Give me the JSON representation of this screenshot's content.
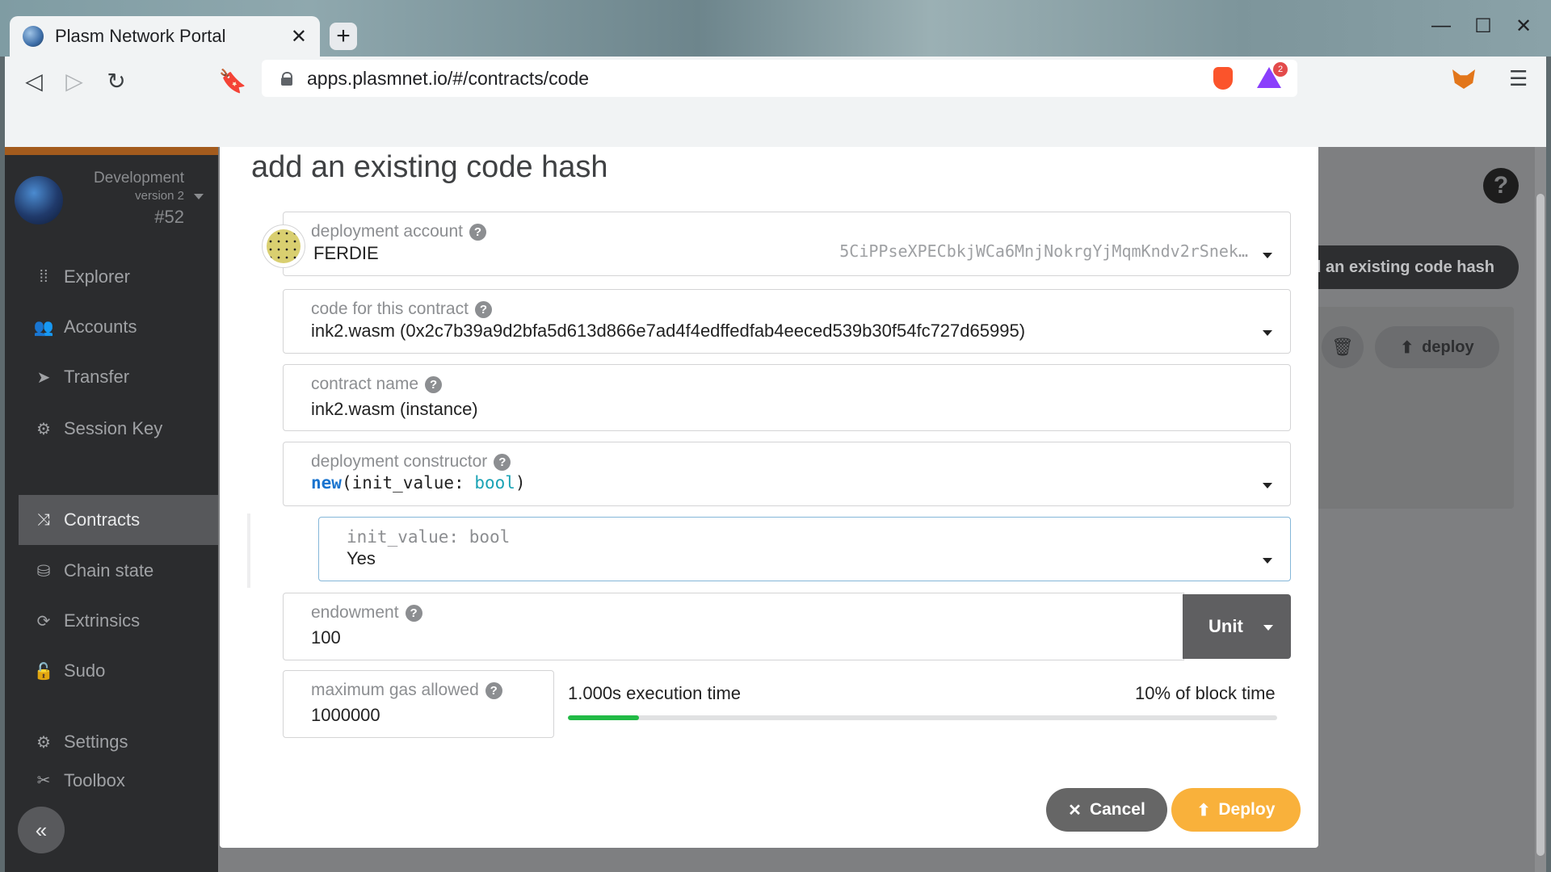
{
  "browser": {
    "tab_title": "Plasm Network Portal",
    "tab_close": "✕",
    "new_tab": "+",
    "url": "apps.plasmnet.io/#/contracts/code",
    "rewards_badge": "2",
    "window": {
      "minimize": "—",
      "maximize": "☐",
      "close": "✕"
    }
  },
  "sidebar": {
    "chain_name": "Development",
    "chain_version": "version 2",
    "block": "#52",
    "items": [
      {
        "label": "Explorer",
        "icon": "explorer-icon",
        "glyph": "⁞⁞"
      },
      {
        "label": "Accounts",
        "icon": "users-icon",
        "glyph": "👥"
      },
      {
        "label": "Transfer",
        "icon": "paper-plane-icon",
        "glyph": "➤"
      },
      {
        "label": "Session Key",
        "icon": "cog-icon",
        "glyph": "⚙"
      },
      {
        "label": "Contracts",
        "icon": "compress-icon",
        "glyph": "⤨"
      },
      {
        "label": "Chain state",
        "icon": "database-icon",
        "glyph": "⛁"
      },
      {
        "label": "Extrinsics",
        "icon": "sync-icon",
        "glyph": "⟳"
      },
      {
        "label": "Sudo",
        "icon": "unlock-icon",
        "glyph": "🔓"
      },
      {
        "label": "Settings",
        "icon": "cogs-icon",
        "glyph": "⚙"
      },
      {
        "label": "Toolbox",
        "icon": "tools-icon",
        "glyph": "✂"
      }
    ],
    "collapse": "«"
  },
  "background": {
    "help": "?",
    "add_button": "Add an existing code hash",
    "deploy": "deploy"
  },
  "modal": {
    "title": "add an existing code hash",
    "account": {
      "label": "deployment account",
      "name": "FERDIE",
      "address": "5CiPPseXPECbkjWCa6MnjNokrgYjMqmKndv2rSnek…"
    },
    "code": {
      "label": "code for this contract",
      "value": "ink2.wasm (0x2c7b39a9d2bfa5d613d866e7ad4f4edffedfab4eeced539b30f54fc727d65995)"
    },
    "name": {
      "label": "contract name",
      "value": "ink2.wasm (instance)"
    },
    "constructor": {
      "label": "deployment constructor",
      "fn": "new",
      "open": "(",
      "param": "init_value: ",
      "type": "bool",
      "close": ")"
    },
    "init_value": {
      "label": "init_value: bool",
      "value": "Yes"
    },
    "endowment": {
      "label": "endowment",
      "value": "100",
      "unit": "Unit"
    },
    "gas": {
      "label": "maximum gas allowed",
      "value": "1000000",
      "execution_time": "1.000s execution time",
      "block_time": "10% of block time",
      "fill_fraction": 0.1
    },
    "cancel": "Cancel",
    "deploy": "Deploy"
  }
}
